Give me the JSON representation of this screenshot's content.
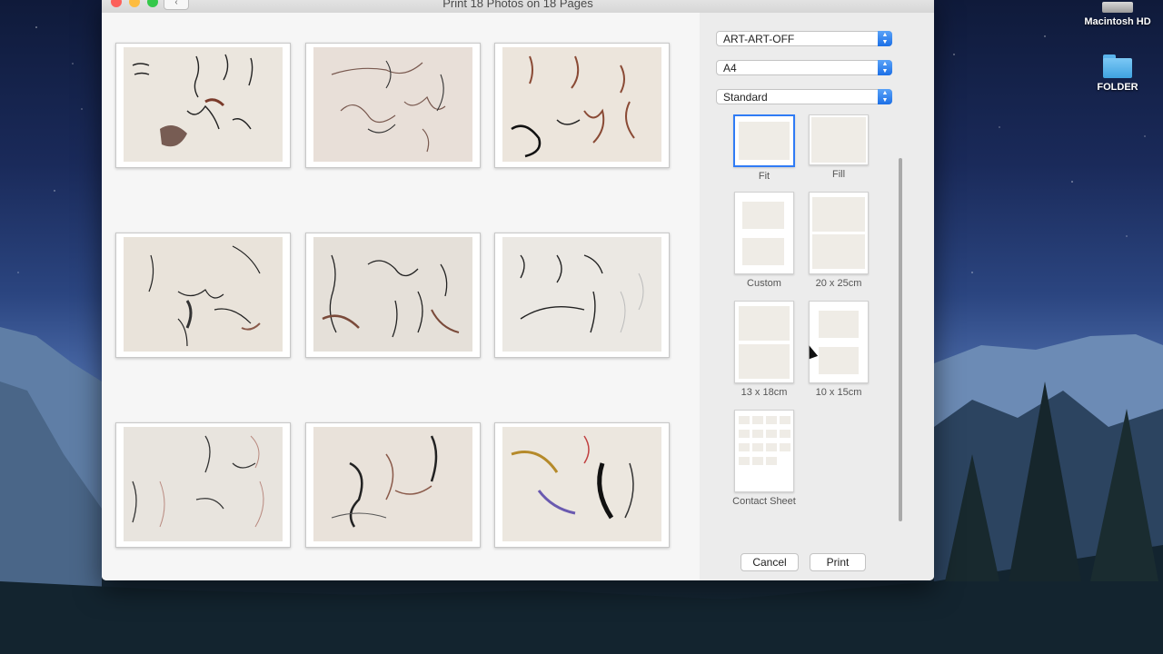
{
  "desktop": {
    "icons": [
      {
        "label": "Macintosh HD",
        "icon": "hard-drive-icon"
      },
      {
        "label": "FOLDER",
        "icon": "folder-icon"
      }
    ]
  },
  "window": {
    "title": "Print 18 Photos on 18 Pages",
    "back_label": "‹"
  },
  "settings": {
    "printer": "ART-ART-OFF",
    "paper_size": "A4",
    "quality": "Standard"
  },
  "layout_options": [
    {
      "label": "Fit",
      "selected": true
    },
    {
      "label": "Fill",
      "selected": false
    },
    {
      "label": "Custom",
      "selected": false
    },
    {
      "label": "20 x 25cm",
      "selected": false
    },
    {
      "label": "13 x 18cm",
      "selected": false
    },
    {
      "label": "10 x 15cm",
      "selected": false
    },
    {
      "label": "Contact Sheet",
      "selected": false
    }
  ],
  "buttons": {
    "cancel": "Cancel",
    "print": "Print"
  },
  "colors": {
    "accent": "#2f7bf5",
    "close": "#fc605b",
    "minimize": "#fdbc40",
    "maximize": "#34c84a"
  }
}
